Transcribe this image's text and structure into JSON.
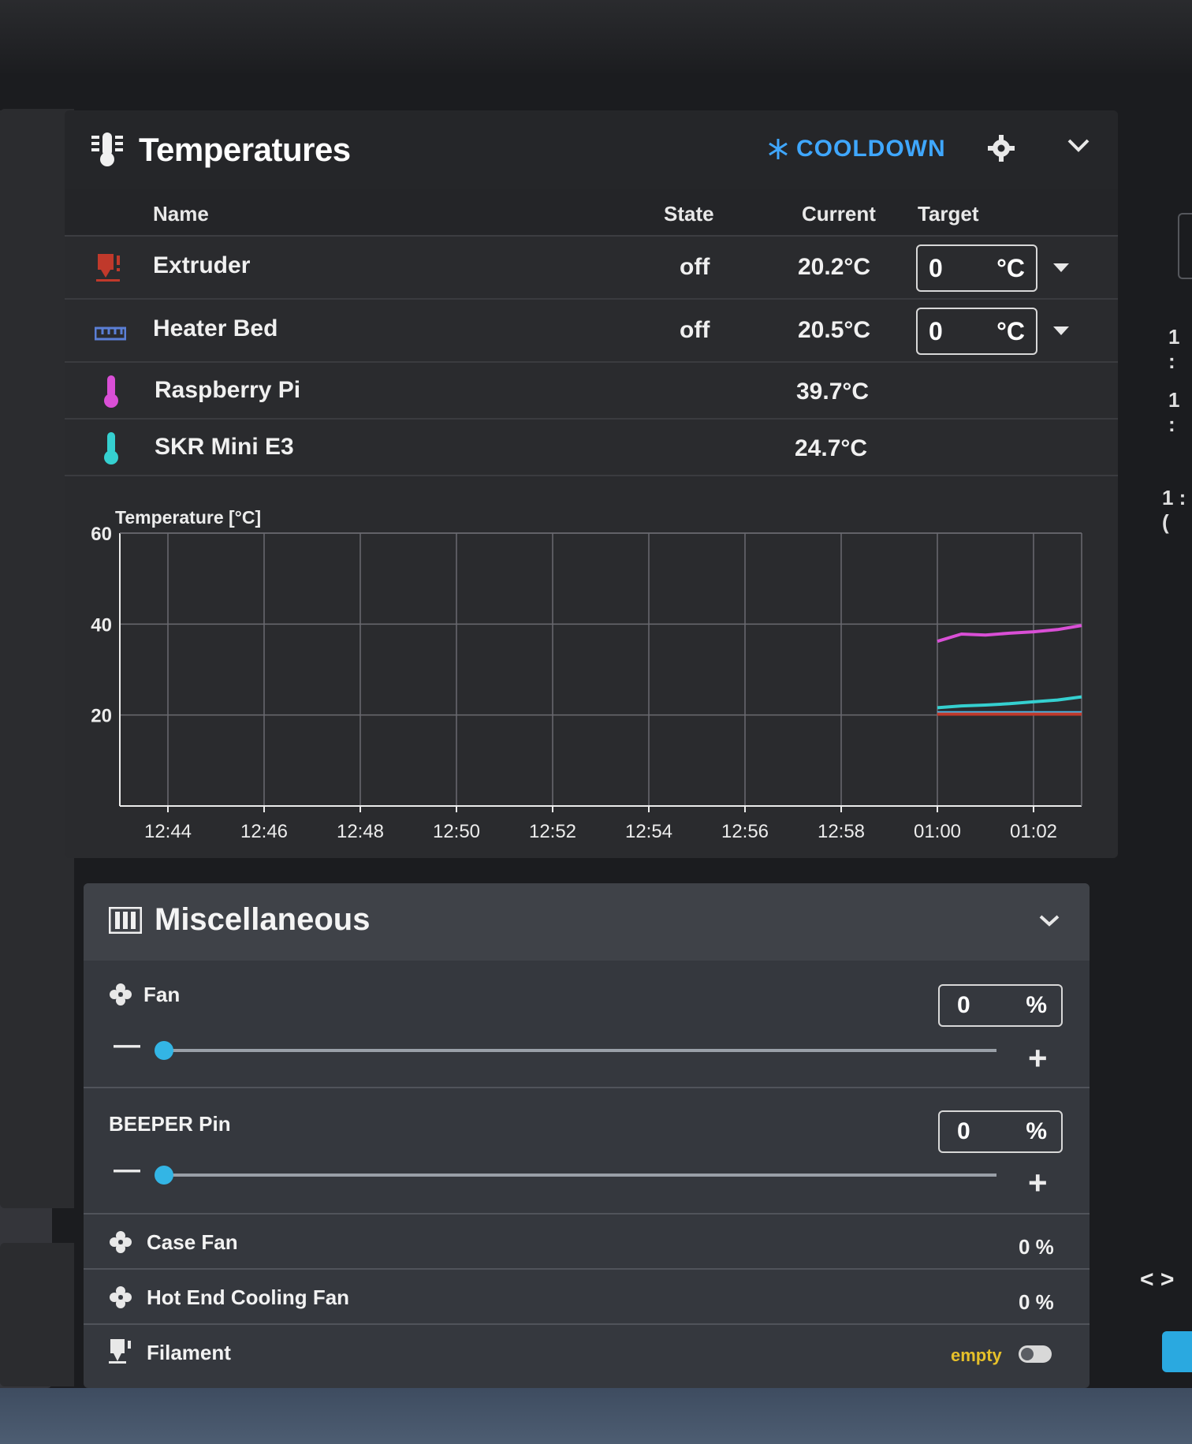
{
  "temperatures": {
    "title": "Temperatures",
    "cooldown_label": "COOLDOWN",
    "columns": {
      "name": "Name",
      "state": "State",
      "current": "Current",
      "target": "Target"
    },
    "rows": [
      {
        "name": "Extruder",
        "state": "off",
        "current": "20.2°C",
        "target_value": "0",
        "target_unit": "°C",
        "icon": "extruder-icon",
        "color": "#c0392b"
      },
      {
        "name": "Heater Bed",
        "state": "off",
        "current": "20.5°C",
        "target_value": "0",
        "target_unit": "°C",
        "icon": "heater-bed-icon",
        "color": "#5b7fd6"
      },
      {
        "name": "Raspberry Pi",
        "current": "39.7°C",
        "icon": "thermometer-icon",
        "color": "#d94fd6"
      },
      {
        "name": "SKR Mini E3",
        "current": "24.7°C",
        "icon": "thermometer-icon",
        "color": "#35d0d0"
      }
    ]
  },
  "chart_data": {
    "type": "line",
    "ylabel": "Temperature [°C]",
    "ylim": [
      0,
      60
    ],
    "yticks": [
      20,
      40,
      60
    ],
    "xticks": [
      "12:44",
      "12:46",
      "12:48",
      "12:50",
      "12:52",
      "12:54",
      "12:56",
      "12:58",
      "01:00",
      "01:02"
    ],
    "x_range": [
      "12:43",
      "01:03"
    ],
    "grid": true,
    "series": [
      {
        "color": "#d94fd6",
        "x": [
          "01:00",
          "01:00:30",
          "01:01",
          "01:01:30",
          "01:02",
          "01:02:30",
          "01:03"
        ],
        "y": [
          36.2,
          37.8,
          37.6,
          38.0,
          38.3,
          38.8,
          39.7
        ]
      },
      {
        "color": "#35d0d0",
        "x": [
          "01:00",
          "01:00:30",
          "01:01",
          "01:01:30",
          "01:02",
          "01:02:30",
          "01:03"
        ],
        "y": [
          21.6,
          22.0,
          22.2,
          22.5,
          22.9,
          23.3,
          24.0
        ]
      },
      {
        "color": "#4ab8e8",
        "x": [
          "01:00",
          "01:01",
          "01:02",
          "01:03"
        ],
        "y": [
          20.5,
          20.5,
          20.5,
          20.5
        ]
      },
      {
        "color": "#c0392b",
        "x": [
          "01:00",
          "01:01",
          "01:02",
          "01:03"
        ],
        "y": [
          20.2,
          20.2,
          20.2,
          20.2
        ]
      }
    ]
  },
  "misc": {
    "title": "Miscellaneous",
    "fan": {
      "label": "Fan",
      "value": "0",
      "unit": "%",
      "level": 0
    },
    "beeper": {
      "label": "BEEPER Pin",
      "value": "0",
      "unit": "%",
      "level": 0
    },
    "case_fan": {
      "label": "Case Fan",
      "value": "0 %"
    },
    "hotend_fan": {
      "label": "Hot End Cooling Fan",
      "value": "0 %"
    },
    "filament": {
      "label": "Filament",
      "status": "empty"
    }
  },
  "side": {
    "left_pct_1": "%",
    "left_pct_2": "%",
    "right_times": [
      "1 :",
      "1 :",
      "1 :("
    ]
  },
  "colors": {
    "accent": "#3fa7ff",
    "slider": "#33b5e5",
    "warning": "#e6c02a"
  }
}
